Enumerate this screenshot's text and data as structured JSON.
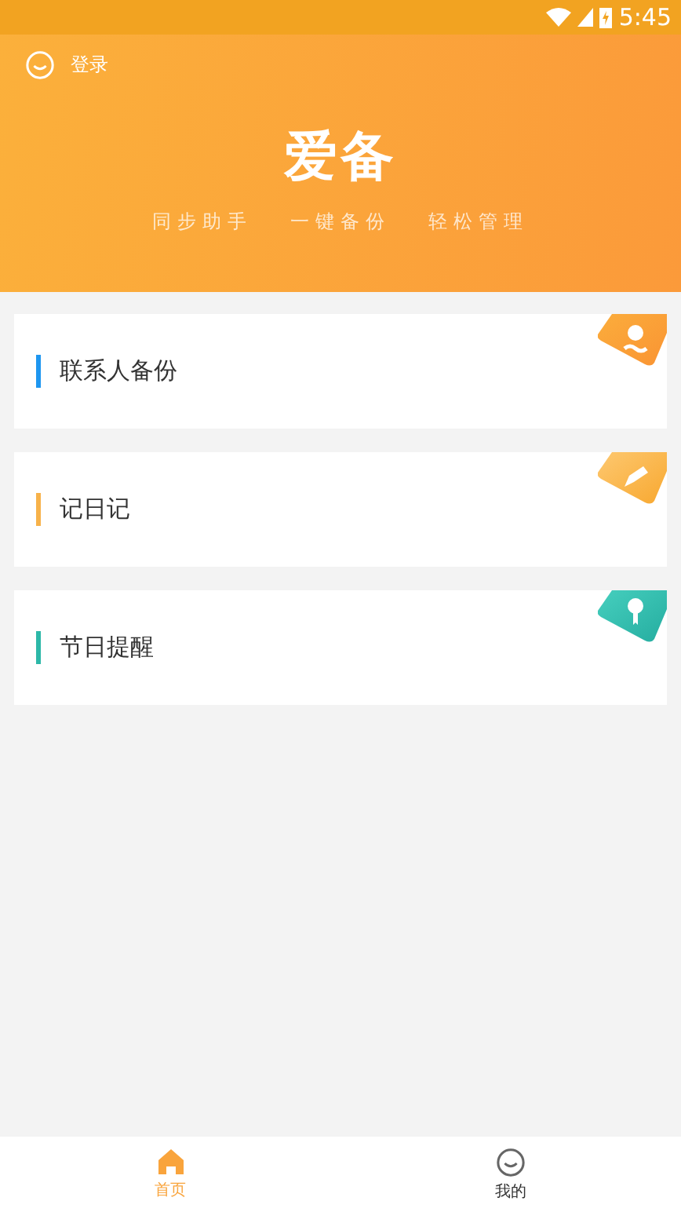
{
  "status_bar": {
    "time": "5:45"
  },
  "header": {
    "login": "登录",
    "logo": "爱备",
    "slogans": [
      "同步助手",
      "一键备份",
      "轻松管理"
    ]
  },
  "cards": [
    {
      "label": "联系人备份",
      "color": "#1e96f0",
      "kind": "person"
    },
    {
      "label": "记日记",
      "color": "#f7b24a",
      "kind": "pencil"
    },
    {
      "label": "节日提醒",
      "color": "#2db8a8",
      "kind": "pin"
    }
  ],
  "nav": [
    {
      "label": "首页",
      "kind": "home",
      "selected": true
    },
    {
      "label": "我的",
      "kind": "face",
      "selected": false
    }
  ]
}
